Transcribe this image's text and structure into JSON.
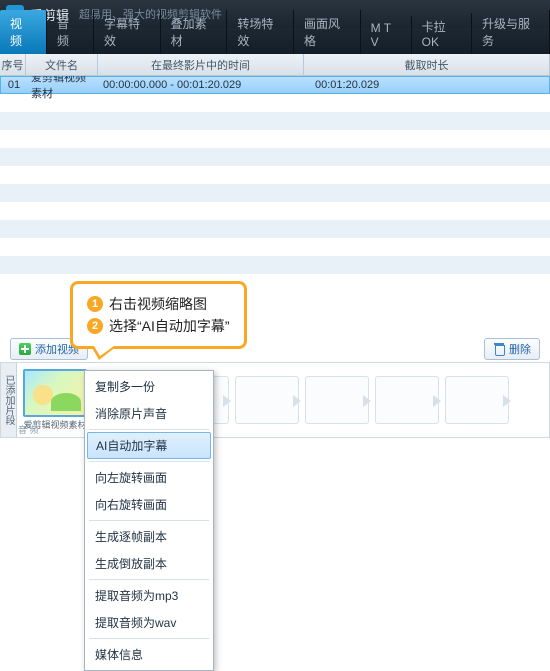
{
  "header": {
    "app_name": "爱剪辑",
    "tagline": "超易用、强大的视频剪辑软件"
  },
  "main_tabs": [
    "视 频",
    "音 频",
    "字幕特效",
    "叠加素材",
    "转场特效",
    "画面风格",
    "M T V",
    "卡拉OK",
    "升级与服务"
  ],
  "sub_cols": {
    "c1": "序号",
    "c2": "文件名",
    "c3": "在最终影片中的时间",
    "c4": "截取时长"
  },
  "row": {
    "idx": "01",
    "file": "爱剪辑视频素材",
    "range": "00:00:00.000 - 00:01:20.029",
    "dur": "00:01:20.029"
  },
  "callout": {
    "l1": "右击视频缩略图",
    "l2": "选择“AI自动加字幕”",
    "n1": "1",
    "n2": "2"
  },
  "buttons": {
    "add": "添加视频",
    "del": "删除"
  },
  "strip": {
    "label": "已添加片段",
    "clip_name": "爱剪辑视频素材",
    "footer": "音 频"
  },
  "menu": {
    "copy": "复制多一份",
    "mute": "消除原片声音",
    "ai": "AI自动加字幕",
    "rotl": "向左旋转画面",
    "rotr": "向右旋转画面",
    "frame": "生成逐帧副本",
    "rev": "生成倒放副本",
    "mp3": "提取音频为mp3",
    "wav": "提取音频为wav",
    "info": "媒体信息"
  }
}
